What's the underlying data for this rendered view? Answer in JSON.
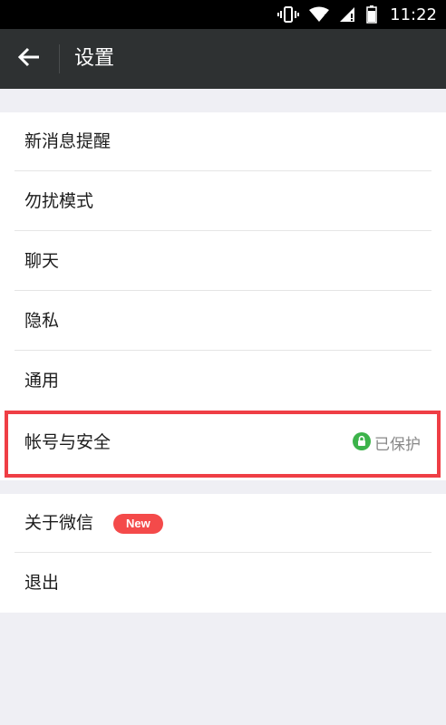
{
  "status_bar": {
    "time": "11:22",
    "icons": [
      "vibrate-icon",
      "wifi-icon",
      "signal-icon",
      "battery-icon"
    ]
  },
  "header": {
    "back_icon": "back-arrow-icon",
    "title": "设置"
  },
  "settings": {
    "group1": [
      {
        "label": "新消息提醒"
      },
      {
        "label": "勿扰模式"
      },
      {
        "label": "聊天"
      },
      {
        "label": "隐私"
      },
      {
        "label": "通用"
      },
      {
        "label": "帐号与安全",
        "status": "已保护",
        "status_icon": "lock-icon"
      }
    ],
    "group2": [
      {
        "label": "关于微信",
        "badge": "New"
      },
      {
        "label": "退出"
      }
    ]
  },
  "colors": {
    "app_bar": "#2e3132",
    "background": "#efeff4",
    "highlight": "#ef3e45",
    "badge": "#f44a4a",
    "protect_green": "#3cb34a"
  }
}
